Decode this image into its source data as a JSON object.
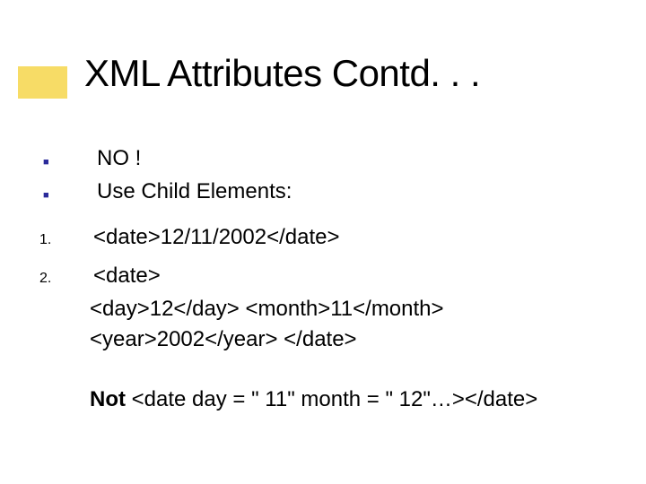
{
  "title": "XML Attributes Contd. . .",
  "bullets": [
    "NO !",
    "Use Child Elements:"
  ],
  "numbered": [
    {
      "n": "1.",
      "text": "<date>12/11/2002</date>"
    },
    {
      "n": "2.",
      "text": "<date>"
    }
  ],
  "cont_lines": [
    "<day>12</day> <month>11</month>",
    "<year>2002</year> </date>"
  ],
  "not_label": "Not",
  "not_rest": " <date day = \" 11\" month = \" 12\"…></date>"
}
